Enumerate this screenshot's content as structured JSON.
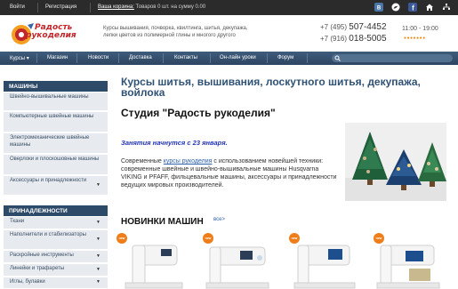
{
  "topbar": {
    "login": "Войти",
    "register": "Регистрация",
    "cart_link": "Ваша корзина:",
    "cart_status": "Товаров 0 шт. на сумму 0.00",
    "social_icons": [
      "vk-icon",
      "twitter-icon",
      "facebook-icon",
      "home-icon",
      "sitemap-icon"
    ]
  },
  "header": {
    "logo_line1": "Радость",
    "logo_line2": "рукоделия",
    "tagline": "Курсы вышивания, лоскутного шитья, декупажа, лепки цветов из полимерной глины и многого другого",
    "tagline_lines": [
      "Курсы вышивания, почворка, квилтинга, шитья, декупажа,",
      "лепки цветов из полимерной глины и многого другого"
    ],
    "phone1_prefix": "+7 (495)",
    "phone1_number": "507-4452",
    "phone2_prefix": "+7 (916)",
    "phone2_number": "018-5005",
    "hours": "11:00 - 19:00"
  },
  "nav": {
    "items": [
      "Курсы ▾",
      "Магазин",
      "Новости",
      "Доставка",
      "Контакты",
      "Он-лайн уроки",
      "Форум"
    ],
    "search_placeholder": ""
  },
  "sidebar": {
    "section1_title": "МАШИНЫ",
    "section1_items": [
      {
        "label": "Швейно-вышивальные машины"
      },
      {
        "label": "Компьютерные швейные машины"
      },
      {
        "label": "Электромеханические швейные машины"
      },
      {
        "label": "Оверлоки и плоскошовные машины"
      },
      {
        "label": "Аксессуары и принадлежности",
        "arrow": "▼"
      }
    ],
    "section2_title": "ПРИНАДЛЕЖНОСТИ",
    "section2_items": [
      {
        "label": "Ткани",
        "arrow": "▼"
      },
      {
        "label": "Наполнители и стабилизаторы",
        "arrow": "▼"
      },
      {
        "label": "Раскройные инструменты",
        "arrow": "▼"
      },
      {
        "label": "Линейки и трафареты",
        "arrow": "▼"
      },
      {
        "label": "Иглы, булавки",
        "arrow": "▼"
      }
    ]
  },
  "main": {
    "title": "Курсы шитья, вышивания, лоскутного шитья, декупажа, войлока",
    "studio": "Студия \"Радость рукоделия\"",
    "classes_start": "Занятия  начнутся с 23 января.",
    "desc_before": "Современные ",
    "desc_link": "курсы рукоделия",
    "desc_after": " с использованием новейшей техники: современные швейные и швейно-вышивальные машины Husqvarna VIKING и PFAFF, фильцевальные машины, аксессуары и принадлежности ведущих мировых производителей.",
    "new_heading": "НОВИНКИ МАШИН",
    "new_all": "все>",
    "badge": "new"
  },
  "colors": {
    "nav_bg": "#2d4560",
    "title_blue": "#2f5275",
    "accent_orange": "#ee7d1a",
    "logo_red": "#c3262b",
    "classes_blue": "#2233b8"
  }
}
